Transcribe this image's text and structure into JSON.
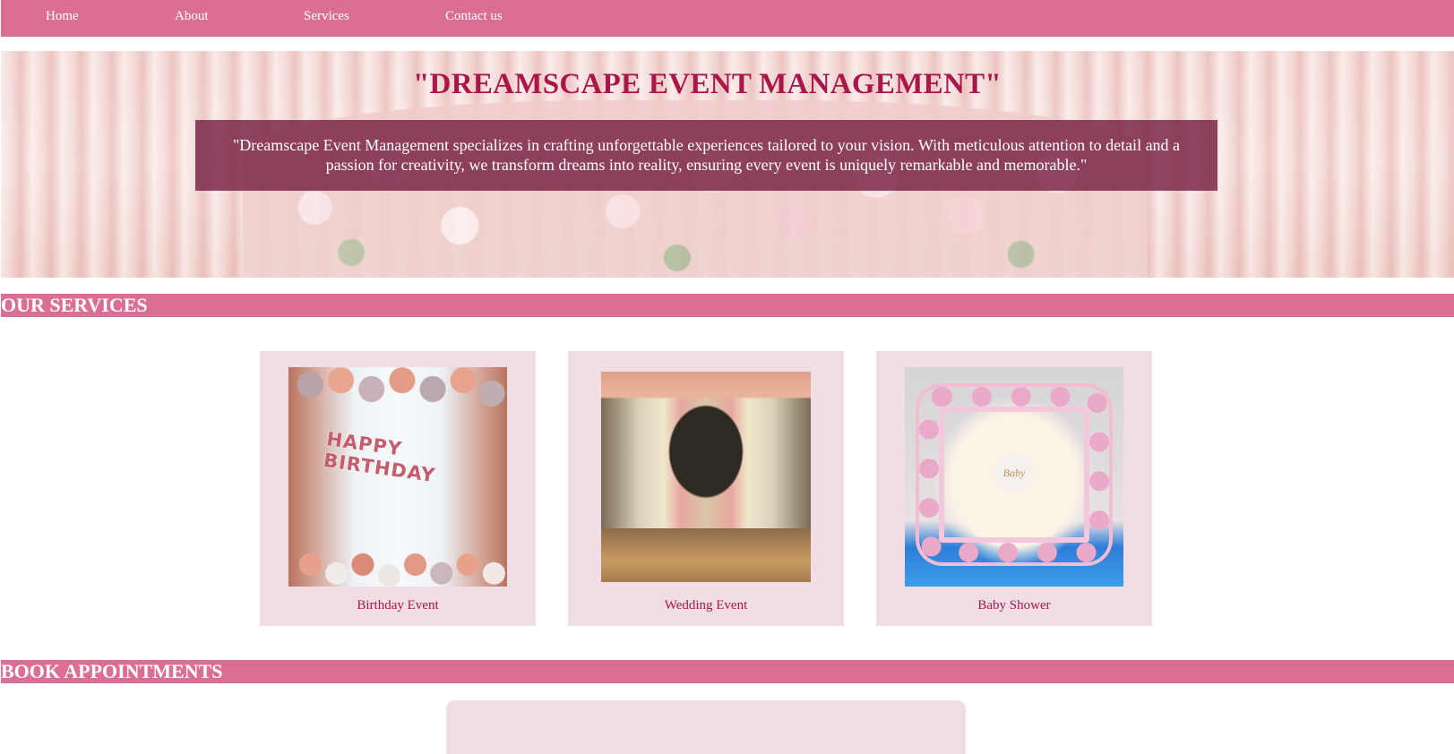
{
  "nav": {
    "items": [
      {
        "label": "Home"
      },
      {
        "label": "About"
      },
      {
        "label": "Services"
      },
      {
        "label": "Contact us"
      }
    ]
  },
  "hero": {
    "title": "\"DREAMSCAPE EVENT MANAGEMENT\"",
    "description": "\"Dreamscape Event Management specializes in crafting unforgettable experiences tailored to your vision. With meticulous attention to detail and a passion for creativity, we transform dreams into reality, ensuring every event is uniquely remarkable and memorable.\""
  },
  "services": {
    "heading": "OUR SERVICES",
    "cards": [
      {
        "label": "Birthday Event",
        "image_text": "HAPPY BIRTHDAY"
      },
      {
        "label": "Wedding Event"
      },
      {
        "label": "Baby Shower",
        "image_text": "Baby"
      }
    ]
  },
  "booking": {
    "heading": "BOOK APPOINTMENTS"
  },
  "colors": {
    "accent": "#db6f92",
    "title": "#a8164a",
    "card_bg": "#f0dde5",
    "hero_box": "#762042"
  }
}
